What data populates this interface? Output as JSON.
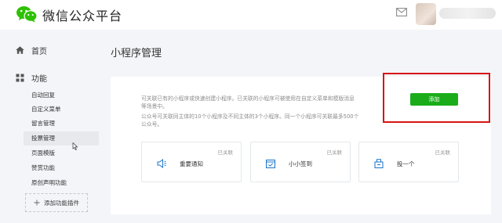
{
  "header": {
    "logo_icon": "wechat-logo-icon",
    "title": "微信公众平台",
    "mail_icon": "mail-icon"
  },
  "sidebar": {
    "home": {
      "icon": "home-icon",
      "label": "首页"
    },
    "functions": {
      "icon": "grid-icon",
      "label": "功能",
      "items": [
        {
          "label": "自动回复"
        },
        {
          "label": "自定义菜单"
        },
        {
          "label": "留言管理"
        },
        {
          "label": "投票管理",
          "active": true
        },
        {
          "label": "页面模版"
        },
        {
          "label": "赞赏功能"
        },
        {
          "label": "原创声明功能"
        }
      ]
    },
    "add_plugin": {
      "icon": "plus-icon",
      "label": "添加功能插件"
    }
  },
  "main": {
    "page_title": "小程序管理",
    "description": {
      "line1": "可关联已有的小程序或快速创建小程序。已关联的小程序可被使用在自定义菜单和模版消息",
      "line2": "等场景中。",
      "line3": "公众号可关联同主体的10个小程序及不同主体的3个小程序。同一个小程序可关联最多500个",
      "line4": "公众号。"
    },
    "add_button": "添加",
    "highlight_color": "#d81414",
    "accent_color": "#1aad19",
    "mini_programs": [
      {
        "name": "重要通知",
        "status": "已关联",
        "icon": "megaphone-icon"
      },
      {
        "name": "小小签到",
        "status": "已关联",
        "icon": "calendar-check-icon"
      },
      {
        "name": "投一个",
        "status": "已关联",
        "icon": "ballot-box-icon"
      }
    ]
  }
}
